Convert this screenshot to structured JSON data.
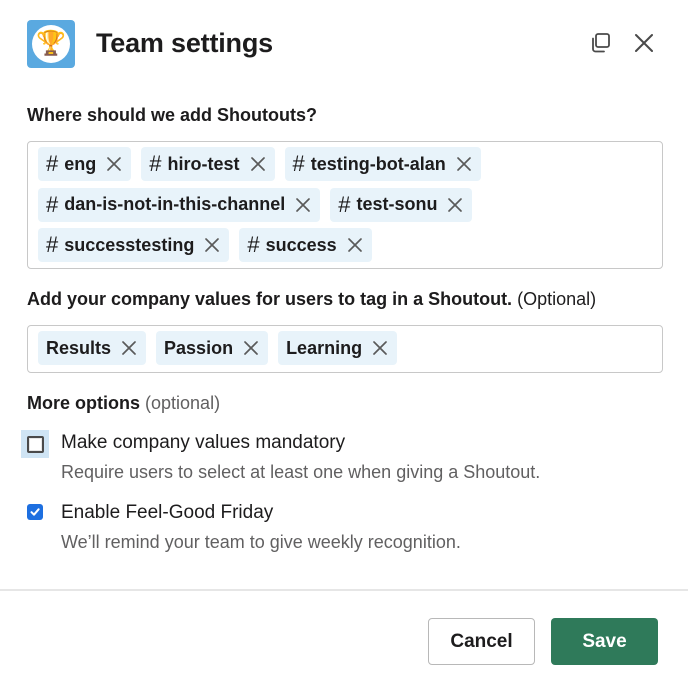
{
  "header": {
    "app_icon": "trophy-icon",
    "app_icon_glyph": "🏆",
    "title": "Team settings",
    "popout_icon": "popout-icon",
    "close_icon": "close-icon"
  },
  "channels_section": {
    "label": "Where should we add Shoutouts?",
    "tags": [
      {
        "prefix": "#",
        "label": "eng"
      },
      {
        "prefix": "#",
        "label": "hiro-test"
      },
      {
        "prefix": "#",
        "label": "testing-bot-alan"
      },
      {
        "prefix": "#",
        "label": "dan-is-not-in-this-channel"
      },
      {
        "prefix": "#",
        "label": "test-sonu"
      },
      {
        "prefix": "#",
        "label": "successtesting"
      },
      {
        "prefix": "#",
        "label": "success"
      }
    ]
  },
  "values_section": {
    "label": "Add your company values for users to tag in a Shoutout.",
    "optional": "(Optional)",
    "tags": [
      {
        "label": "Results"
      },
      {
        "label": "Passion"
      },
      {
        "label": "Learning"
      }
    ]
  },
  "more_options": {
    "label": "More options",
    "optional": "(optional)",
    "options": [
      {
        "title": "Make company values mandatory",
        "description": "Require users to select at least one when giving a Shoutout.",
        "checked": false
      },
      {
        "title": "Enable Feel-Good Friday",
        "description": "We’ll remind your team to give weekly recognition.",
        "checked": true
      }
    ]
  },
  "footer": {
    "cancel_label": "Cancel",
    "save_label": "Save"
  },
  "colors": {
    "accent_save": "#2f7a5a",
    "tag_background": "#e8f3fa",
    "checkbox_checked": "#1d6fe0",
    "app_icon_background": "#5aa9e0"
  }
}
